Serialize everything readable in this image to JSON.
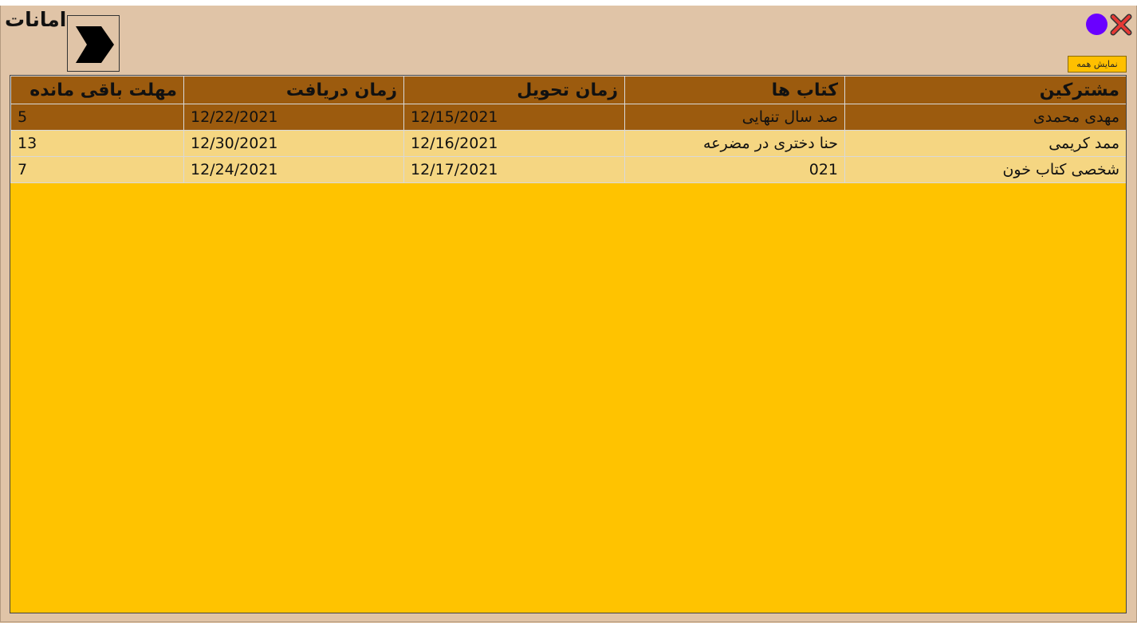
{
  "window": {
    "title": "امانات",
    "colors": {
      "background": "#e0c4a7",
      "header": "#9c5b0e",
      "grid_background": "#ffc300",
      "row": "#f5d682",
      "minimize": "#6a00ff",
      "close": "#e53935"
    }
  },
  "toolbar": {
    "back_icon": "chevron-right-icon",
    "minimize_icon": "circle-icon",
    "close_icon": "close-icon",
    "show_all_label": "نمایش همه"
  },
  "table": {
    "columns": [
      "مشترکین",
      "کتاب ها",
      "زمان تحویل",
      "زمان دریافت",
      "مهلت باقی مانده"
    ],
    "rows": [
      {
        "member": "مهدی محمدی",
        "book": "صد سال تنهایی",
        "delivery": "12/15/2021",
        "receive": "12/22/2021",
        "remaining": "5",
        "selected": true
      },
      {
        "member": "ممد کریمی",
        "book": "حنا دختری در مضرعه",
        "delivery": "12/16/2021",
        "receive": "12/30/2021",
        "remaining": "13",
        "selected": false
      },
      {
        "member": "شخصی  کتاب خون",
        "book": "021",
        "delivery": "12/17/2021",
        "receive": "12/24/2021",
        "remaining": "7",
        "selected": false
      }
    ]
  }
}
